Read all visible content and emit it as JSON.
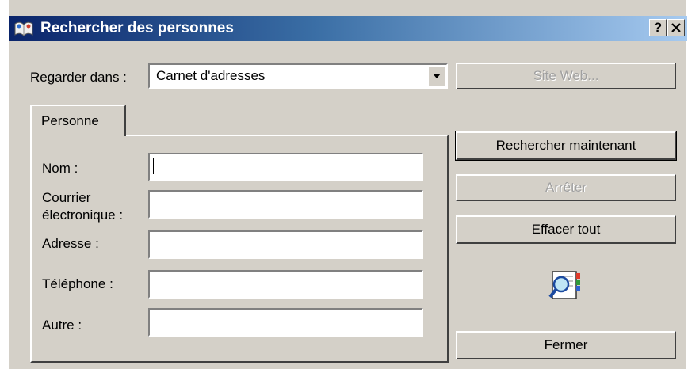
{
  "window": {
    "title": "Rechercher des personnes",
    "help_button": "?",
    "close_button": "✕"
  },
  "look_in": {
    "label": "Regarder dans :",
    "value": "Carnet d'adresses"
  },
  "buttons": {
    "website": "Site Web...",
    "search_now": "Rechercher maintenant",
    "stop": "Arrêter",
    "clear_all": "Effacer tout",
    "close": "Fermer"
  },
  "tab": {
    "label": "Personne"
  },
  "fields": {
    "name_label": "Nom :",
    "email_label_line1": "Courrier",
    "email_label_line2": "électronique :",
    "address_label": "Adresse :",
    "phone_label": "Téléphone :",
    "other_label": "Autre :",
    "name_value": "",
    "email_value": "",
    "address_value": "",
    "phone_value": "",
    "other_value": ""
  },
  "icons": {
    "title": "address-book-icon",
    "search_illustration": "book-magnifier-icon"
  }
}
